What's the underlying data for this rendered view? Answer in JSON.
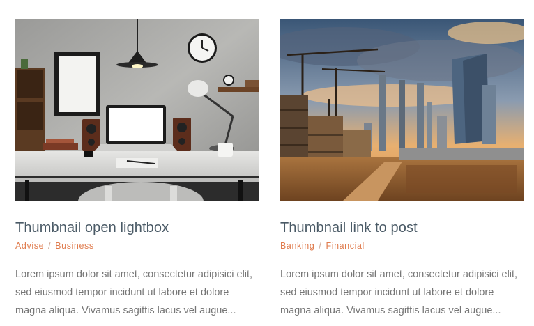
{
  "posts": [
    {
      "title": "Thumbnail open lightbox",
      "categories": [
        "Advise",
        "Business"
      ],
      "separator": "/",
      "excerpt_lines": [
        "Lorem ipsum dolor sit amet, consectetur adipisici elit,",
        "sed eiusmod tempor incidunt ut labore et dolore",
        "magna aliqua. Vivamus sagittis lacus vel augue..."
      ]
    },
    {
      "title": "Thumbnail link to post",
      "categories": [
        "Banking",
        "Financial"
      ],
      "separator": "/",
      "excerpt_lines": [
        "Lorem ipsum dolor sit amet, consectetur adipisici elit,",
        "sed eiusmod tempor incidunt ut labore et dolore",
        "magna aliqua. Vivamus sagittis lacus vel augue..."
      ]
    }
  ],
  "colors": {
    "title": "#4a5a66",
    "category": "#e07c4e",
    "excerpt": "#767676"
  }
}
